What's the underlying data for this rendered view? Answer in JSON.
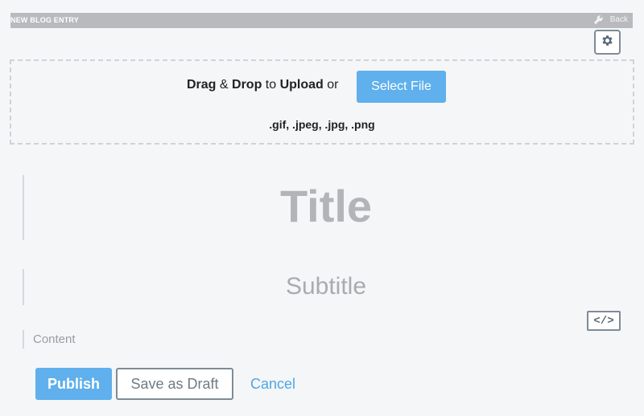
{
  "header": {
    "title": "NEW BLOG ENTRY",
    "back_label": "Back",
    "back_icon": "wrench-icon"
  },
  "settings": {
    "icon": "gear-icon"
  },
  "upload": {
    "drag": "Drag",
    "amp": " & ",
    "drop": "Drop",
    "to": " to ",
    "upload": "Upload",
    "or": " or ",
    "select_file_label": "Select File",
    "file_types": ".gif, .jpeg, .jpg, .png"
  },
  "editor": {
    "title_placeholder": "Title",
    "subtitle_placeholder": "Subtitle",
    "html_toggle_label": "</>",
    "content_placeholder": "Content"
  },
  "actions": {
    "publish_label": "Publish",
    "save_draft_label": "Save as Draft",
    "cancel_label": "Cancel"
  },
  "colors": {
    "accent": "#5fb0ec",
    "link": "#4ea7e6",
    "header_bar": "#b8babd",
    "border": "#7d8c98"
  }
}
